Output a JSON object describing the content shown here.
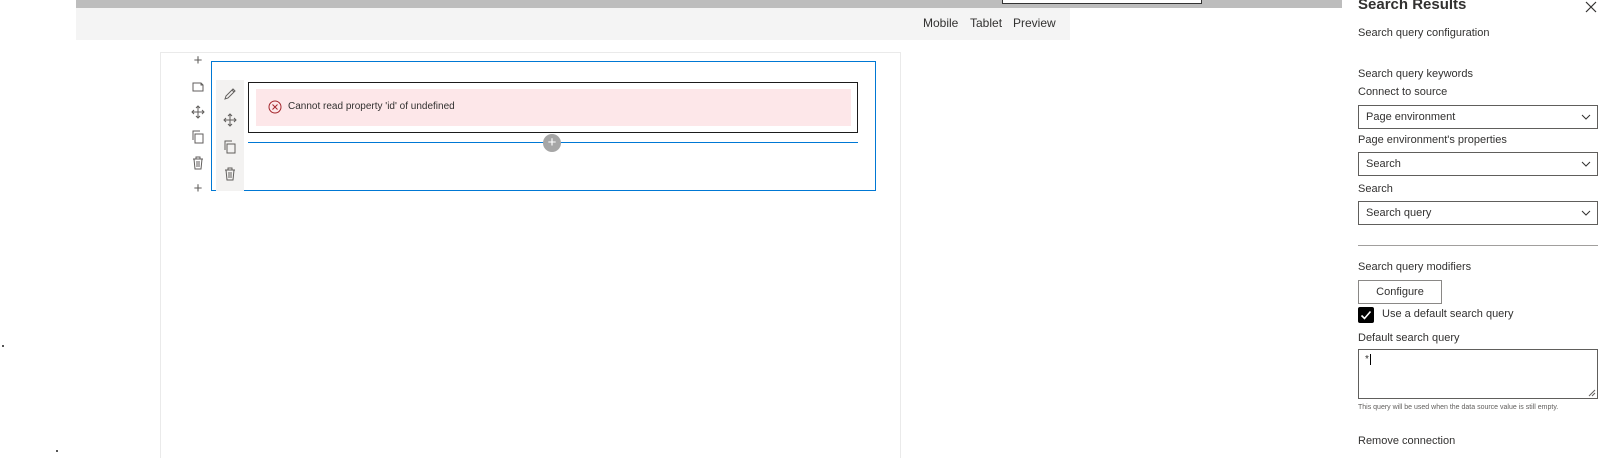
{
  "toolbar": {
    "mobile_label": "Mobile",
    "tablet_label": "Tablet",
    "preview_label": "Preview"
  },
  "canvas": {
    "section_side_icons": [
      "add-icon",
      "edit-section-icon",
      "move-icon",
      "duplicate-icon",
      "delete-icon",
      "add-icon"
    ],
    "webpart_tools": [
      "edit-icon",
      "move-icon",
      "duplicate-icon",
      "delete-icon"
    ],
    "error_message": "Cannot read property 'id' of undefined",
    "colors": {
      "accent": "#0078d4",
      "error_bg": "#fde7e9"
    }
  },
  "pane": {
    "title": "Search Results",
    "section_heading": "Search query configuration",
    "keywords_label": "Search query keywords",
    "connect_label": "Connect to source",
    "connect_value": "Page environment",
    "properties_label": "Page environment's properties",
    "properties_value": "Search",
    "search_label": "Search",
    "search_value": "Search query",
    "modifiers_label": "Search query modifiers",
    "configure_label": "Configure",
    "default_checkbox_label": "Use a default search query",
    "default_checkbox_checked": true,
    "default_query_label": "Default search query",
    "default_query_value": "*",
    "default_query_hint": "This query will be used when the data source value is still empty.",
    "remove_connection_label": "Remove connection"
  }
}
